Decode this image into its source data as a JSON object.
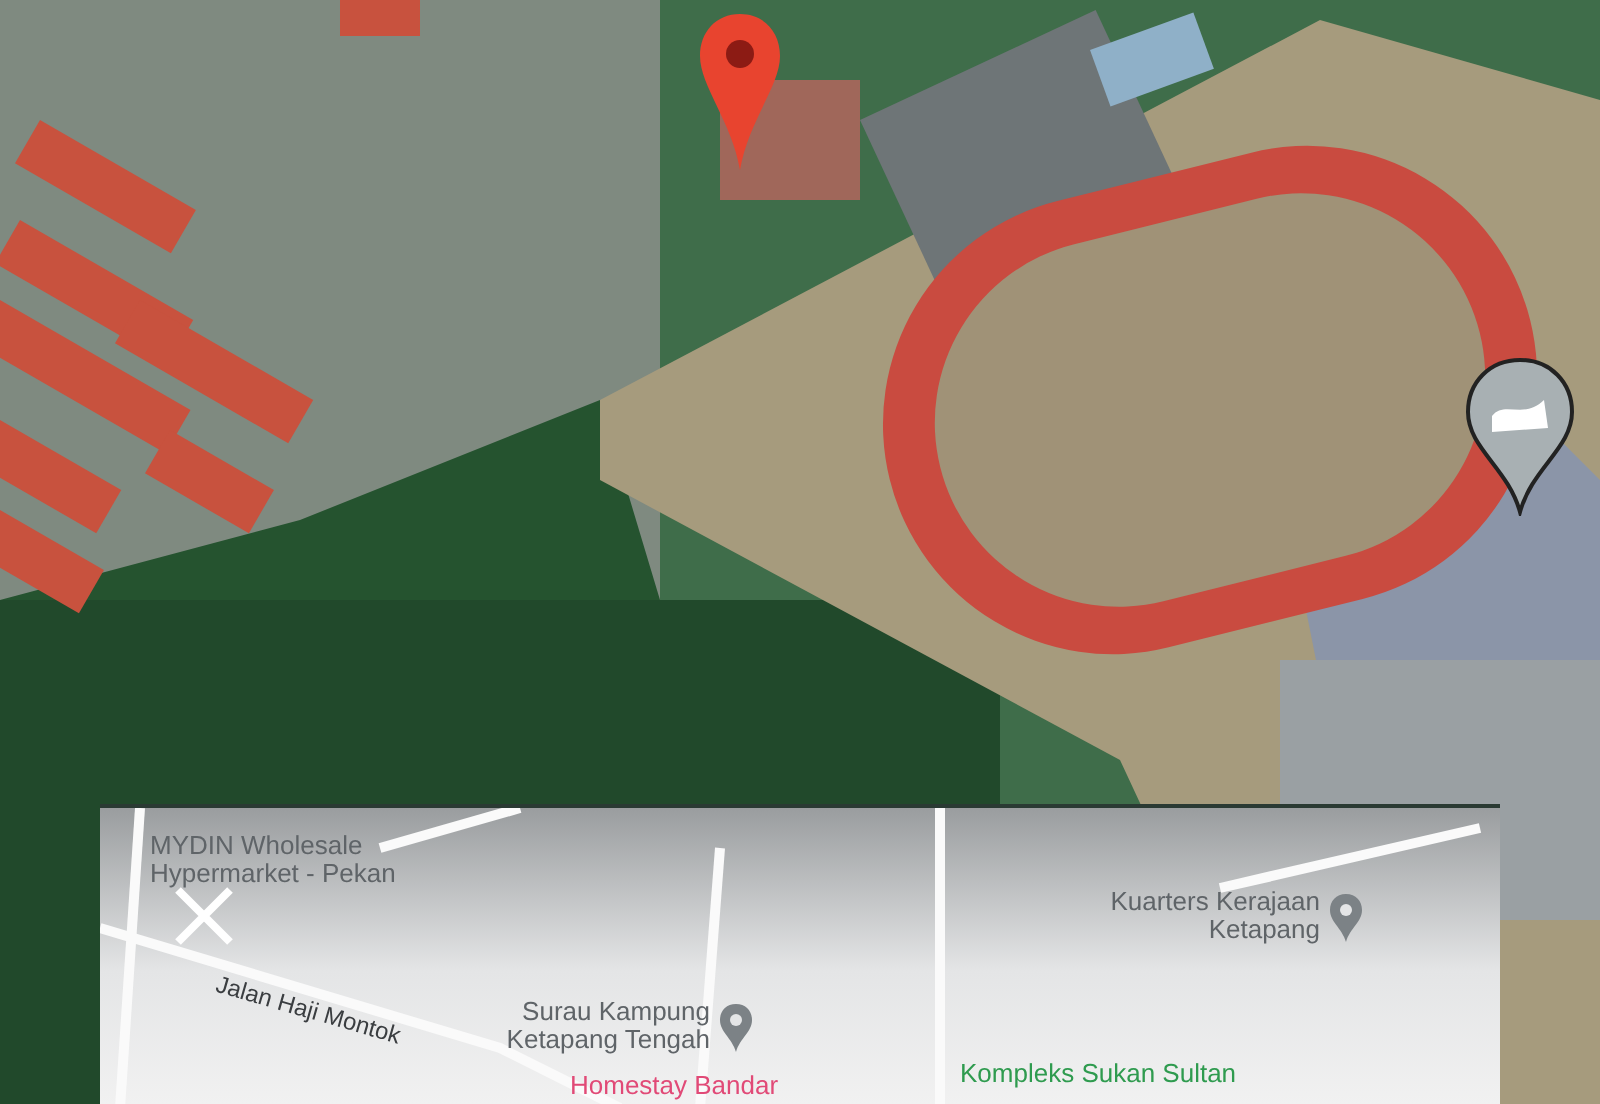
{
  "satellite_view": {
    "markers": [
      {
        "kind": "location-pin"
      },
      {
        "kind": "sports-venue"
      }
    ]
  },
  "map_preview": {
    "labels": [
      {
        "kind": "poi",
        "text": "MYDIN Wholesale Hypermarket - Pekan",
        "pin": false
      },
      {
        "kind": "poi",
        "text": "Kuarters Kerajaan Ketapang",
        "pin": true
      },
      {
        "kind": "road",
        "text": "Jalan Haji Montok",
        "pin": false
      },
      {
        "kind": "poi",
        "text": "Surau Kampung Ketapang Tengah",
        "pin": true
      },
      {
        "kind": "lodging",
        "text": "Homestay Bandar",
        "pin": false
      },
      {
        "kind": "park",
        "text": "Kompleks Sukan Sultan",
        "pin": false
      }
    ]
  }
}
